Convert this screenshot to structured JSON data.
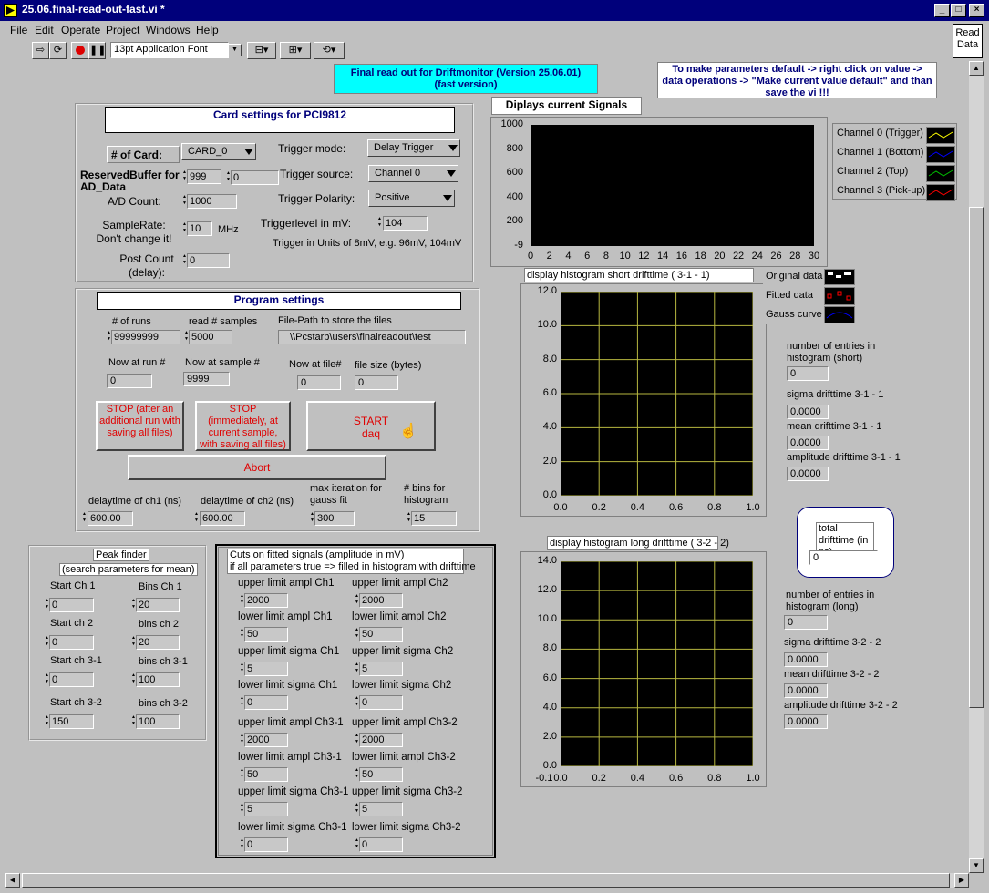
{
  "window": {
    "title": "25.06.final-read-out-fast.vi *",
    "min": "_",
    "max": "□",
    "close": "×"
  },
  "menu": [
    "File",
    "Edit",
    "Operate",
    "Project",
    "Windows",
    "Help"
  ],
  "toolbar": {
    "font": "13pt Application Font",
    "read_data": "Read Data"
  },
  "header": {
    "final": "Final read out for Driftmonitor (Version 25.06.01)",
    "final2": "(fast version)",
    "defaults": "To make parameters default -> right click on value -> data operations -> \"Make current value default\" and than save the vi !!!"
  },
  "card": {
    "title": "Card settings for PCI9812",
    "num_card_label": "# of Card:",
    "num_card": "CARD_0",
    "reserved_label": "ReservedBuffer for AD_Data",
    "reserved1": "999",
    "reserved2": "0",
    "ad_count_label": "A/D Count:",
    "ad_count": "1000",
    "sample_rate_label": "SampleRate: Don't change it!",
    "sample_rate": "10",
    "mhz": "MHz",
    "post_count_label": "Post Count (delay):",
    "post_count": "0",
    "trig_mode_label": "Trigger mode:",
    "trig_mode": "Delay Trigger",
    "trig_src_label": "Trigger source:",
    "trig_src": "Channel 0",
    "trig_pol_label": "Trigger Polarity:",
    "trig_pol": "Positive",
    "trig_level_label": "Triggerlevel in mV:",
    "trig_level": "104",
    "trig_note": "Trigger in Units of 8mV, e.g. 96mV, 104mV"
  },
  "program": {
    "title": "Program settings",
    "runs_label": "# of runs",
    "runs": "99999999",
    "samples_label": "read # samples",
    "samples": "5000",
    "path_label": "File-Path to store the files",
    "path": "\\\\Pcstarb\\users\\finalreadout\\test",
    "now_run_label": "Now at run #",
    "now_run": "0",
    "now_sample_label": "Now at sample #",
    "now_sample": "9999",
    "now_file_label": "Now at file#",
    "now_file": "0",
    "file_size_label": "file size (bytes)",
    "file_size": "0",
    "stop1": "STOP (after an additional run with saving all files)",
    "stop2": "STOP (immediately, at current sample, with saving all files)",
    "start": "START daq",
    "abort": "Abort",
    "delay1_label": "delaytime of ch1 (ns)",
    "delay1": "600.00",
    "delay2_label": "delaytime of ch2 (ns)",
    "delay2": "600.00",
    "maxiter_label": "max iteration for gauss fit",
    "maxiter": "300",
    "bins_label": "# bins for histogram",
    "bins": "15"
  },
  "peak": {
    "title": "Peak finder",
    "subtitle": "(search parameters for mean)",
    "start1_label": "Start Ch 1",
    "start1": "0",
    "bins1_label": "Bins Ch 1",
    "bins1": "20",
    "start2_label": "Start ch 2",
    "start2": "0",
    "bins2_label": "bins ch 2",
    "bins2": "20",
    "start31_label": "Start ch 3-1",
    "start31": "0",
    "bins31_label": "bins ch 3-1",
    "bins31": "100",
    "start32_label": "Start ch 3-2",
    "start32": "150",
    "bins32_label": "bins ch 3-2",
    "bins32": "100"
  },
  "cuts": {
    "title": "Cuts on fitted signals (amplitude in mV)",
    "title2": "if all parameters true => filled in histogram with drifttime",
    "fields": [
      {
        "label": "upper limit ampl Ch1",
        "value": "2000"
      },
      {
        "label": "upper limit ampl Ch2",
        "value": "2000"
      },
      {
        "label": "lower limit ampl Ch1",
        "value": "50"
      },
      {
        "label": "lower limit ampl Ch2",
        "value": "50"
      },
      {
        "label": "upper limit sigma Ch1",
        "value": "5"
      },
      {
        "label": "upper limit sigma Ch2",
        "value": "5"
      },
      {
        "label": "lower limit sigma Ch1",
        "value": "0"
      },
      {
        "label": "lower limit sigma Ch2",
        "value": "0"
      },
      {
        "label": "upper limit ampl Ch3-1",
        "value": "2000"
      },
      {
        "label": "upper limit ampl Ch3-2",
        "value": "2000"
      },
      {
        "label": "lower limit ampl Ch3-1",
        "value": "50"
      },
      {
        "label": "lower limit ampl Ch3-2",
        "value": "50"
      },
      {
        "label": "upper limit sigma Ch3-1",
        "value": "5"
      },
      {
        "label": "upper limit sigma Ch3-2",
        "value": "5"
      },
      {
        "label": "lower limit sigma Ch3-1",
        "value": "0"
      },
      {
        "label": "lower limit sigma Ch3-2",
        "value": "0"
      }
    ]
  },
  "signals": {
    "title": "Diplays current Signals",
    "yticks": [
      "1000",
      "800",
      "600",
      "400",
      "200",
      "-9"
    ],
    "xticks": [
      "0",
      "2",
      "4",
      "6",
      "8",
      "10",
      "12",
      "14",
      "16",
      "18",
      "20",
      "22",
      "24",
      "26",
      "28",
      "30"
    ],
    "legend": [
      {
        "label": "Channel 0 (Trigger)",
        "color": "#ffff00"
      },
      {
        "label": "Channel 1 (Bottom)",
        "color": "#0000ff"
      },
      {
        "label": "Channel 2 (Top)",
        "color": "#00c000"
      },
      {
        "label": "Channel 3 (Pick-up)",
        "color": "#ff0000"
      }
    ]
  },
  "hist_short": {
    "title": "display histogram short drifttime ( 3-1 - 1)",
    "yticks": [
      "12.0",
      "10.0",
      "8.0",
      "6.0",
      "4.0",
      "2.0",
      "0.0"
    ],
    "xticks": [
      "0.0",
      "0.2",
      "0.4",
      "0.6",
      "0.8",
      "1.0"
    ],
    "legend": [
      "Original data",
      "Fitted data",
      "Gauss curve"
    ],
    "entries_label": "number of entries in histogram (short)",
    "entries": "0",
    "sigma_label": "sigma drifttime 3-1 - 1",
    "sigma": "0.0000",
    "mean_label": "mean drifttime 3-1 - 1",
    "mean": "0.0000",
    "amp_label": "amplitude drifttime 3-1 - 1",
    "amp": "0.0000"
  },
  "total": {
    "label": "total drifttime (in ns)",
    "value": "0"
  },
  "hist_long": {
    "title": "display histogram long drifttime ( 3-2 - 2)",
    "yticks": [
      "14.0",
      "12.0",
      "10.0",
      "8.0",
      "6.0",
      "4.0",
      "2.0",
      "0.0"
    ],
    "xticks": [
      "-0.1",
      "0.0",
      "0.2",
      "0.4",
      "0.6",
      "0.8",
      "1.0"
    ],
    "entries_label": "number of entries in histogram (long)",
    "entries": "0",
    "sigma_label": "sigma drifttime 3-2 - 2",
    "sigma": "0.0000",
    "mean_label": "mean drifttime 3-2 - 2",
    "mean": "0.0000",
    "amp_label": "amplitude drifttime 3-2 - 2",
    "amp": "0.0000"
  }
}
